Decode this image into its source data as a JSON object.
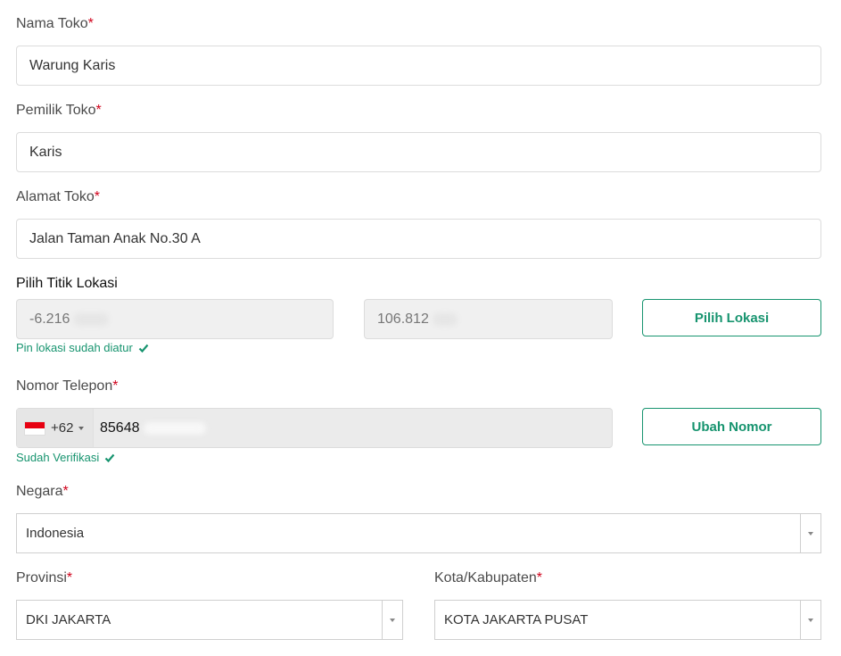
{
  "form": {
    "required_mark": "*",
    "store_name": {
      "label": "Nama Toko",
      "value": "Warung Karis"
    },
    "owner": {
      "label": "Pemilik Toko",
      "value": "Karis"
    },
    "address": {
      "label": "Alamat Toko",
      "value": "Jalan Taman Anak No.30 A"
    },
    "location": {
      "label": "Pilih Titik Lokasi",
      "lat": "-6.216",
      "lng": "106.812",
      "button": "Pilih Lokasi",
      "status": "Pin lokasi sudah diatur"
    },
    "phone": {
      "label": "Nomor Telepon",
      "country_code": "+62",
      "number": "85648",
      "button": "Ubah Nomor",
      "status": "Sudah Verifikasi"
    },
    "country": {
      "label": "Negara",
      "value": "Indonesia"
    },
    "province": {
      "label": "Provinsi",
      "value": "DKI JAKARTA"
    },
    "city": {
      "label": "Kota/Kabupaten",
      "value": "KOTA JAKARTA PUSAT"
    }
  },
  "colors": {
    "accent": "#17946f",
    "required": "#d0021b"
  },
  "icons": {
    "check": "check-icon",
    "dropdown": "caret-down-icon",
    "flag": "indonesia-flag-icon"
  }
}
